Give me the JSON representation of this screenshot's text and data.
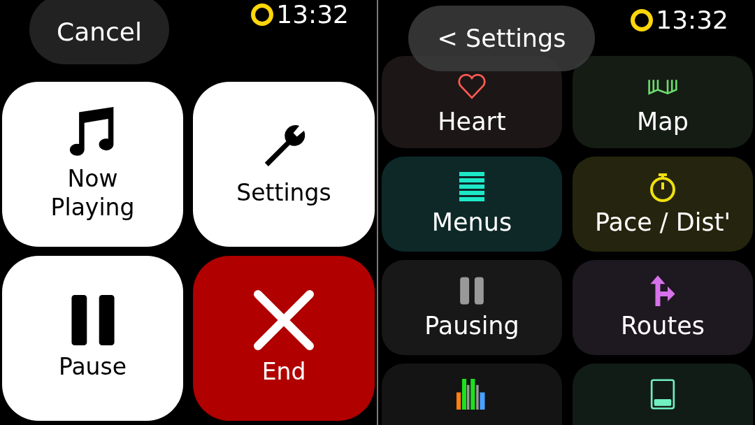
{
  "workout_controls": {
    "cancel": "Cancel",
    "time": "13:32",
    "tiles": [
      {
        "kind": "music",
        "label": "Now Playing",
        "color": "#ffffff"
      },
      {
        "kind": "wrench",
        "label": "Settings",
        "color": "#ffffff"
      },
      {
        "kind": "pause",
        "label": "Pause",
        "color": "#ffffff"
      },
      {
        "kind": "close",
        "label": "End",
        "color": "#b00000"
      }
    ]
  },
  "settings": {
    "back": "< Settings",
    "time": "13:32",
    "tiles": [
      {
        "kind": "heart",
        "label": "Heart",
        "color": "#1c1616"
      },
      {
        "kind": "map",
        "label": "Map",
        "color": "#141c14"
      },
      {
        "kind": "menu",
        "label": "Menus",
        "color": "#0e2828"
      },
      {
        "kind": "stopwatch",
        "label": "Pace / Dist'",
        "color": "#25250f"
      },
      {
        "kind": "pause",
        "label": "Pausing",
        "color": "#181818"
      },
      {
        "kind": "routes",
        "label": "Routes",
        "color": "#1e1820"
      },
      {
        "kind": "bars",
        "color": "#141414"
      },
      {
        "kind": "screen",
        "color": "#121c16"
      }
    ]
  }
}
